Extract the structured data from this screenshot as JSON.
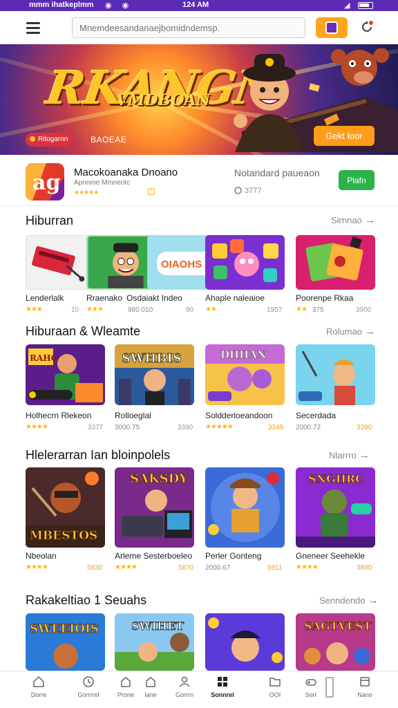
{
  "status_bar": {
    "carrier": "mmm ihatkeplmm",
    "icons_left": "◉ ◉",
    "time": "124 AM",
    "signal": "◢"
  },
  "top_bar": {
    "search_placeholder": "Mnemdeesandanaejbomidndemsp.",
    "menu_icon": "hamburger-icon",
    "search_button_icon": "search-icon",
    "notification_icon": "bell-icon"
  },
  "banner": {
    "title": "RKANGN",
    "subtitle": "VMDBOAN",
    "pill_label": "Ritogarnn",
    "caption": "BAOEAE",
    "cta_label": "Gekt Ioor"
  },
  "featured": {
    "name": "Macokoanaka Dnoano",
    "subtitle": "Apnnme Mmneotc",
    "stars": "★★★★★",
    "middle_title": "Notandard paueaon",
    "middle_meta": "3777",
    "button_label": "Plafn"
  },
  "sections": [
    {
      "title": "Hiburran",
      "more_label": "Sirnnao",
      "cards": [
        {
          "name": "Lenderlalk",
          "stars": "★★★",
          "meta": "",
          "count": "10"
        },
        {
          "name": "Rraenako",
          "stars": "★★★",
          "meta": "",
          "count": ""
        },
        {
          "name": "Osdaiakt Indeo",
          "stars": "",
          "meta": "980 010",
          "count": "90"
        },
        {
          "name": "Ahaple naleaioe",
          "stars": "★★",
          "meta": "",
          "count": "1957"
        },
        {
          "name": "Poorenpe Rkaa",
          "stars": "★★",
          "meta": "375",
          "count": "3900"
        }
      ]
    },
    {
      "title": "Hiburaan & Wleamte",
      "more_label": "Rolumao",
      "cards": [
        {
          "name": "Holhecrn Rlekeon",
          "stars": "★★★★",
          "meta": "",
          "count": "3377"
        },
        {
          "name": "Rolloeglal",
          "stars": "",
          "meta": "3000.75",
          "count": "3390"
        },
        {
          "name": "Soldderloeandoon",
          "stars": "★★★★★",
          "meta": "",
          "count": "3349"
        },
        {
          "name": "Secerdada",
          "stars": "",
          "meta": "2000.72",
          "count": "3390"
        }
      ]
    },
    {
      "title": "Hlelerarran Ian bloinpolels",
      "more_label": "Nlarrro",
      "cards": [
        {
          "name": "Nbeolan",
          "stars": "★★★★",
          "meta": "",
          "count": "5830"
        },
        {
          "name": "Arleme Sesterboeleo",
          "stars": "★★★★",
          "meta": "",
          "count": "5870"
        },
        {
          "name": "Perler Gonteng",
          "stars": "",
          "meta": "2000.67",
          "count": "5911"
        },
        {
          "name": "Gneneer Seehekle",
          "stars": "★★★★",
          "meta": "",
          "count": "3890"
        }
      ]
    },
    {
      "title": "Rakakeltiao 1 Seuahs",
      "more_label": "Senndendo",
      "tiles": [
        "SWEEIOIS",
        "SWIHET",
        "",
        "SAGTVEST"
      ]
    }
  ],
  "bottom_nav": [
    {
      "label": "Dorre",
      "icon": "home-icon"
    },
    {
      "label": "Gorrrrel",
      "icon": "clock-icon"
    },
    {
      "label": "Prone",
      "icon": "house-icon"
    },
    {
      "label": "Iane",
      "icon": "house-icon"
    },
    {
      "label": "Gorrrn",
      "icon": "user-icon"
    },
    {
      "label": "Sonnrel",
      "icon": "grid-icon"
    },
    {
      "label": "OOI",
      "icon": "folder-icon"
    },
    {
      "label": "Sorr",
      "icon": "gamepad-icon"
    },
    {
      "label": "Nano",
      "icon": "square-icon"
    }
  ],
  "colors": {
    "status_bar": "#5b2bb6",
    "accent_orange": "#ffa41c",
    "install_green": "#2bb34a",
    "star": "#ffb21a"
  }
}
